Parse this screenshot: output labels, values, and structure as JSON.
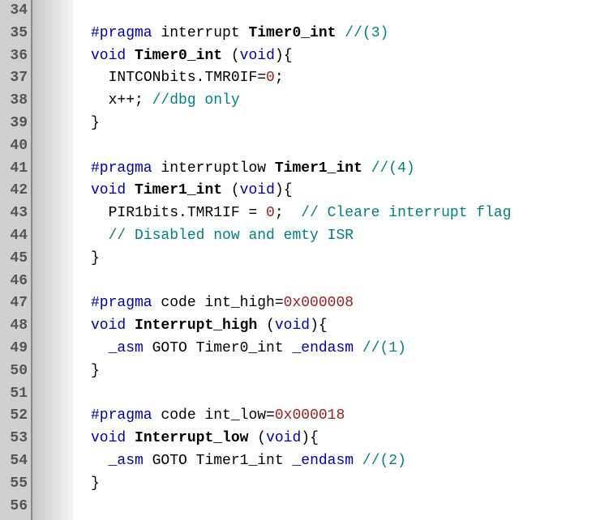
{
  "startLine": 34,
  "lines": [
    {
      "tokens": []
    },
    {
      "indent": 0,
      "tokens": [
        {
          "t": "#pragma",
          "c": "kw"
        },
        {
          "t": " interrupt ",
          "c": "pl"
        },
        {
          "t": "Timer0_int",
          "c": "fn"
        },
        {
          "t": " ",
          "c": "pl"
        },
        {
          "t": "//(3)",
          "c": "cm"
        }
      ]
    },
    {
      "indent": 0,
      "tokens": [
        {
          "t": "void",
          "c": "kw"
        },
        {
          "t": " ",
          "c": "pl"
        },
        {
          "t": "Timer0_int",
          "c": "fn"
        },
        {
          "t": " (",
          "c": "pl"
        },
        {
          "t": "void",
          "c": "kw"
        },
        {
          "t": "){",
          "c": "pl"
        }
      ]
    },
    {
      "indent": 1,
      "tokens": [
        {
          "t": "INTCONbits.TMR0IF=",
          "c": "pl"
        },
        {
          "t": "0",
          "c": "nm"
        },
        {
          "t": ";",
          "c": "pl"
        }
      ]
    },
    {
      "indent": 1,
      "tokens": [
        {
          "t": "x++; ",
          "c": "pl"
        },
        {
          "t": "//dbg only",
          "c": "cm"
        }
      ]
    },
    {
      "indent": 0,
      "tokens": [
        {
          "t": "}",
          "c": "pl"
        }
      ]
    },
    {
      "tokens": []
    },
    {
      "indent": 0,
      "tokens": [
        {
          "t": "#pragma",
          "c": "kw"
        },
        {
          "t": " interruptlow ",
          "c": "pl"
        },
        {
          "t": "Timer1_int",
          "c": "fn"
        },
        {
          "t": " ",
          "c": "pl"
        },
        {
          "t": "//(4)",
          "c": "cm"
        }
      ]
    },
    {
      "indent": 0,
      "tokens": [
        {
          "t": "void",
          "c": "kw"
        },
        {
          "t": " ",
          "c": "pl"
        },
        {
          "t": "Timer1_int",
          "c": "fn"
        },
        {
          "t": " (",
          "c": "pl"
        },
        {
          "t": "void",
          "c": "kw"
        },
        {
          "t": "){",
          "c": "pl"
        }
      ]
    },
    {
      "indent": 1,
      "tokens": [
        {
          "t": "PIR1bits.TMR1IF = ",
          "c": "pl"
        },
        {
          "t": "0",
          "c": "nm"
        },
        {
          "t": ";  ",
          "c": "pl"
        },
        {
          "t": "// Cleare interrupt flag",
          "c": "cm"
        }
      ]
    },
    {
      "indent": 1,
      "tokens": [
        {
          "t": "// Disabled now and emty ISR",
          "c": "cm"
        }
      ]
    },
    {
      "indent": 0,
      "tokens": [
        {
          "t": "}",
          "c": "pl"
        }
      ]
    },
    {
      "tokens": []
    },
    {
      "indent": 0,
      "tokens": [
        {
          "t": "#pragma",
          "c": "kw"
        },
        {
          "t": " code int_high=",
          "c": "pl"
        },
        {
          "t": "0x000008",
          "c": "nm"
        }
      ]
    },
    {
      "indent": 0,
      "tokens": [
        {
          "t": "void",
          "c": "kw"
        },
        {
          "t": " ",
          "c": "pl"
        },
        {
          "t": "Interrupt_high",
          "c": "fn"
        },
        {
          "t": " (",
          "c": "pl"
        },
        {
          "t": "void",
          "c": "kw"
        },
        {
          "t": "){",
          "c": "pl"
        }
      ]
    },
    {
      "indent": 1,
      "tokens": [
        {
          "t": "_asm",
          "c": "kw"
        },
        {
          "t": " GOTO Timer0_int ",
          "c": "pl"
        },
        {
          "t": "_endasm",
          "c": "kw"
        },
        {
          "t": " ",
          "c": "pl"
        },
        {
          "t": "//(1)",
          "c": "cm"
        }
      ]
    },
    {
      "indent": 0,
      "tokens": [
        {
          "t": "}",
          "c": "pl"
        }
      ]
    },
    {
      "tokens": []
    },
    {
      "indent": 0,
      "tokens": [
        {
          "t": "#pragma",
          "c": "kw"
        },
        {
          "t": " code int_low=",
          "c": "pl"
        },
        {
          "t": "0x000018",
          "c": "nm"
        }
      ]
    },
    {
      "indent": 0,
      "tokens": [
        {
          "t": "void",
          "c": "kw"
        },
        {
          "t": " ",
          "c": "pl"
        },
        {
          "t": "Interrupt_low",
          "c": "fn"
        },
        {
          "t": " (",
          "c": "pl"
        },
        {
          "t": "void",
          "c": "kw"
        },
        {
          "t": "){",
          "c": "pl"
        }
      ]
    },
    {
      "indent": 1,
      "tokens": [
        {
          "t": "_asm",
          "c": "kw"
        },
        {
          "t": " GOTO Timer1_int ",
          "c": "pl"
        },
        {
          "t": "_endasm",
          "c": "kw"
        },
        {
          "t": " ",
          "c": "pl"
        },
        {
          "t": "//(2)",
          "c": "cm"
        }
      ]
    },
    {
      "indent": 0,
      "tokens": [
        {
          "t": "}",
          "c": "pl"
        }
      ]
    },
    {
      "tokens": []
    }
  ]
}
